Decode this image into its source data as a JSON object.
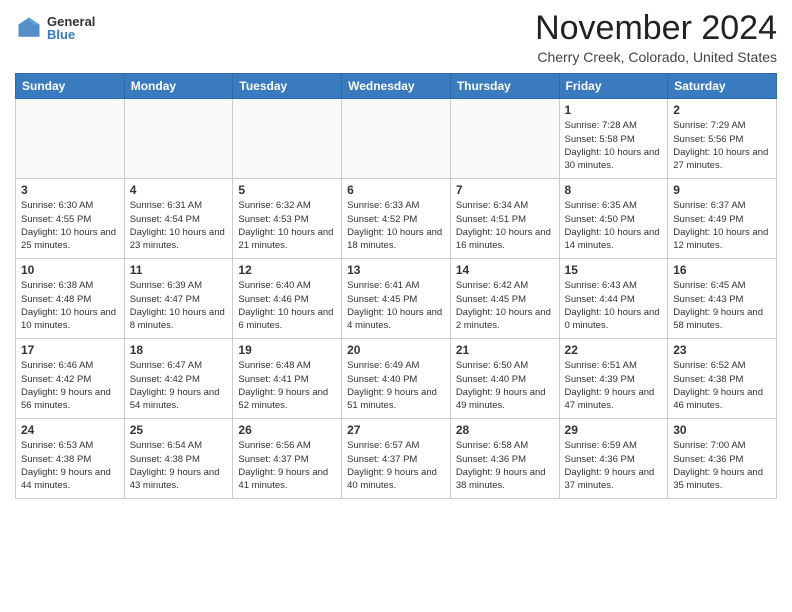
{
  "header": {
    "logo_general": "General",
    "logo_blue": "Blue",
    "month_title": "November 2024",
    "subtitle": "Cherry Creek, Colorado, United States"
  },
  "weekdays": [
    "Sunday",
    "Monday",
    "Tuesday",
    "Wednesday",
    "Thursday",
    "Friday",
    "Saturday"
  ],
  "weeks": [
    [
      {
        "day": "",
        "info": ""
      },
      {
        "day": "",
        "info": ""
      },
      {
        "day": "",
        "info": ""
      },
      {
        "day": "",
        "info": ""
      },
      {
        "day": "",
        "info": ""
      },
      {
        "day": "1",
        "info": "Sunrise: 7:28 AM\nSunset: 5:58 PM\nDaylight: 10 hours and 30 minutes."
      },
      {
        "day": "2",
        "info": "Sunrise: 7:29 AM\nSunset: 5:56 PM\nDaylight: 10 hours and 27 minutes."
      }
    ],
    [
      {
        "day": "3",
        "info": "Sunrise: 6:30 AM\nSunset: 4:55 PM\nDaylight: 10 hours and 25 minutes."
      },
      {
        "day": "4",
        "info": "Sunrise: 6:31 AM\nSunset: 4:54 PM\nDaylight: 10 hours and 23 minutes."
      },
      {
        "day": "5",
        "info": "Sunrise: 6:32 AM\nSunset: 4:53 PM\nDaylight: 10 hours and 21 minutes."
      },
      {
        "day": "6",
        "info": "Sunrise: 6:33 AM\nSunset: 4:52 PM\nDaylight: 10 hours and 18 minutes."
      },
      {
        "day": "7",
        "info": "Sunrise: 6:34 AM\nSunset: 4:51 PM\nDaylight: 10 hours and 16 minutes."
      },
      {
        "day": "8",
        "info": "Sunrise: 6:35 AM\nSunset: 4:50 PM\nDaylight: 10 hours and 14 minutes."
      },
      {
        "day": "9",
        "info": "Sunrise: 6:37 AM\nSunset: 4:49 PM\nDaylight: 10 hours and 12 minutes."
      }
    ],
    [
      {
        "day": "10",
        "info": "Sunrise: 6:38 AM\nSunset: 4:48 PM\nDaylight: 10 hours and 10 minutes."
      },
      {
        "day": "11",
        "info": "Sunrise: 6:39 AM\nSunset: 4:47 PM\nDaylight: 10 hours and 8 minutes."
      },
      {
        "day": "12",
        "info": "Sunrise: 6:40 AM\nSunset: 4:46 PM\nDaylight: 10 hours and 6 minutes."
      },
      {
        "day": "13",
        "info": "Sunrise: 6:41 AM\nSunset: 4:45 PM\nDaylight: 10 hours and 4 minutes."
      },
      {
        "day": "14",
        "info": "Sunrise: 6:42 AM\nSunset: 4:45 PM\nDaylight: 10 hours and 2 minutes."
      },
      {
        "day": "15",
        "info": "Sunrise: 6:43 AM\nSunset: 4:44 PM\nDaylight: 10 hours and 0 minutes."
      },
      {
        "day": "16",
        "info": "Sunrise: 6:45 AM\nSunset: 4:43 PM\nDaylight: 9 hours and 58 minutes."
      }
    ],
    [
      {
        "day": "17",
        "info": "Sunrise: 6:46 AM\nSunset: 4:42 PM\nDaylight: 9 hours and 56 minutes."
      },
      {
        "day": "18",
        "info": "Sunrise: 6:47 AM\nSunset: 4:42 PM\nDaylight: 9 hours and 54 minutes."
      },
      {
        "day": "19",
        "info": "Sunrise: 6:48 AM\nSunset: 4:41 PM\nDaylight: 9 hours and 52 minutes."
      },
      {
        "day": "20",
        "info": "Sunrise: 6:49 AM\nSunset: 4:40 PM\nDaylight: 9 hours and 51 minutes."
      },
      {
        "day": "21",
        "info": "Sunrise: 6:50 AM\nSunset: 4:40 PM\nDaylight: 9 hours and 49 minutes."
      },
      {
        "day": "22",
        "info": "Sunrise: 6:51 AM\nSunset: 4:39 PM\nDaylight: 9 hours and 47 minutes."
      },
      {
        "day": "23",
        "info": "Sunrise: 6:52 AM\nSunset: 4:38 PM\nDaylight: 9 hours and 46 minutes."
      }
    ],
    [
      {
        "day": "24",
        "info": "Sunrise: 6:53 AM\nSunset: 4:38 PM\nDaylight: 9 hours and 44 minutes."
      },
      {
        "day": "25",
        "info": "Sunrise: 6:54 AM\nSunset: 4:38 PM\nDaylight: 9 hours and 43 minutes."
      },
      {
        "day": "26",
        "info": "Sunrise: 6:56 AM\nSunset: 4:37 PM\nDaylight: 9 hours and 41 minutes."
      },
      {
        "day": "27",
        "info": "Sunrise: 6:57 AM\nSunset: 4:37 PM\nDaylight: 9 hours and 40 minutes."
      },
      {
        "day": "28",
        "info": "Sunrise: 6:58 AM\nSunset: 4:36 PM\nDaylight: 9 hours and 38 minutes."
      },
      {
        "day": "29",
        "info": "Sunrise: 6:59 AM\nSunset: 4:36 PM\nDaylight: 9 hours and 37 minutes."
      },
      {
        "day": "30",
        "info": "Sunrise: 7:00 AM\nSunset: 4:36 PM\nDaylight: 9 hours and 35 minutes."
      }
    ]
  ]
}
